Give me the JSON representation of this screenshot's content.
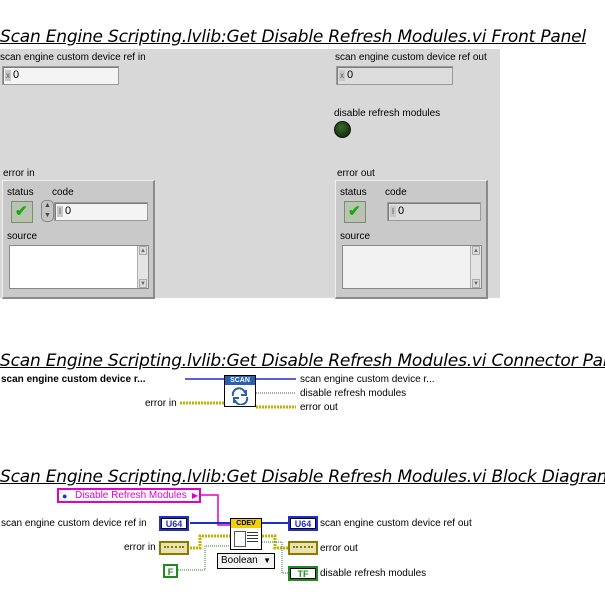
{
  "front_panel": {
    "title": "Scan Engine Scripting.lvlib:Get Disable Refresh Modules.vi Front Panel",
    "ref_in": {
      "label": "scan engine custom device ref in",
      "radix": "x",
      "value": "0"
    },
    "ref_out": {
      "label": "scan engine custom device ref out",
      "radix": "x",
      "value": "0"
    },
    "disable_refresh": {
      "label": "disable refresh modules"
    },
    "error_in": {
      "label": "error in",
      "status_label": "status",
      "code_label": "code",
      "code_value": "0",
      "source_label": "source"
    },
    "error_out": {
      "label": "error out",
      "status_label": "status",
      "code_label": "code",
      "code_value": "0",
      "source_label": "source"
    }
  },
  "connector_pane": {
    "title": "Scan Engine Scripting.lvlib:Get Disable Refresh Modules.vi Connector Pane",
    "left_top": "scan engine custom device r...",
    "left_error": "error in",
    "right_top": "scan engine custom device r...",
    "right_mid": "disable refresh modules",
    "right_error": "error out",
    "icon_text": "SCAN"
  },
  "block_diagram": {
    "title": "Scan Engine Scripting.lvlib:Get Disable Refresh Modules.vi Block Diagram",
    "property": "Disable Refresh Modules",
    "ref_in_label": "scan engine custom device ref in",
    "ref_in_term": "U64",
    "ref_out_label": "scan engine custom device ref out",
    "ref_out_term": "U64",
    "error_in_label": "error in",
    "error_out_label": "error out",
    "false_const": "F",
    "type_label": "Boolean",
    "bool_term": "TF",
    "bool_label": "disable refresh modules",
    "subvi_text": "CDEV"
  },
  "colors": {
    "wire_blue": "#1f2fc8",
    "wire_pink": "#e000c8",
    "wire_error": "#bfb000",
    "wire_bool": "#1f8a1f",
    "panel_bg": "#d8d8d8"
  }
}
